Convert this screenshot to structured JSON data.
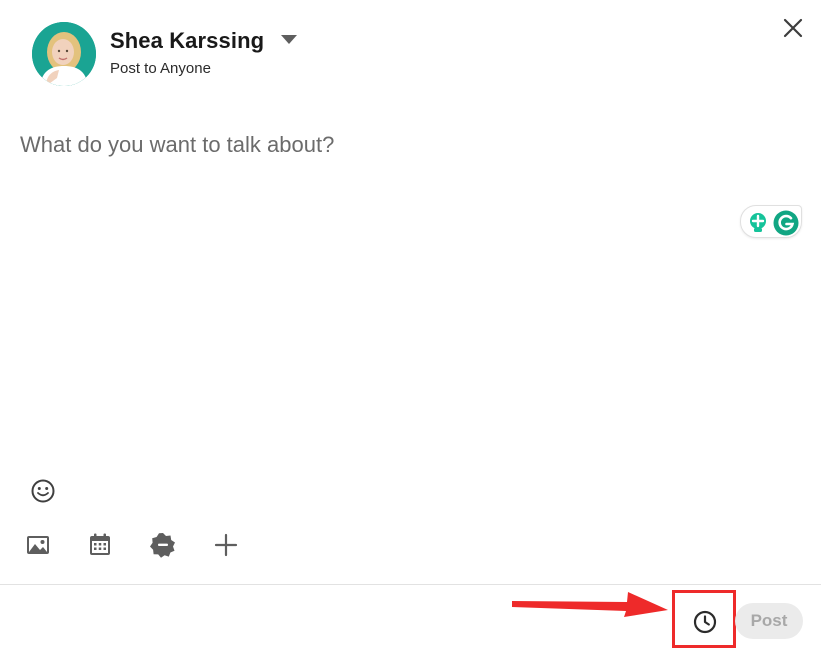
{
  "header": {
    "author_name": "Shea Karssing",
    "audience": "Post to Anyone"
  },
  "editor": {
    "placeholder": "What do you want to talk about?",
    "value": ""
  },
  "toolbar": {
    "items": [
      {
        "icon": "image-icon"
      },
      {
        "icon": "event-calendar-icon"
      },
      {
        "icon": "celebrate-badge-icon"
      },
      {
        "icon": "plus-icon"
      }
    ]
  },
  "footer": {
    "schedule_icon": "clock-icon",
    "post_label": "Post"
  },
  "colors": {
    "avatar_bg": "#1aa493",
    "highlight": "#ee2a2a",
    "post_disabled_bg": "#ebebeb",
    "post_disabled_text": "#a8a8a8",
    "grammarly_green": "#15c39a"
  }
}
